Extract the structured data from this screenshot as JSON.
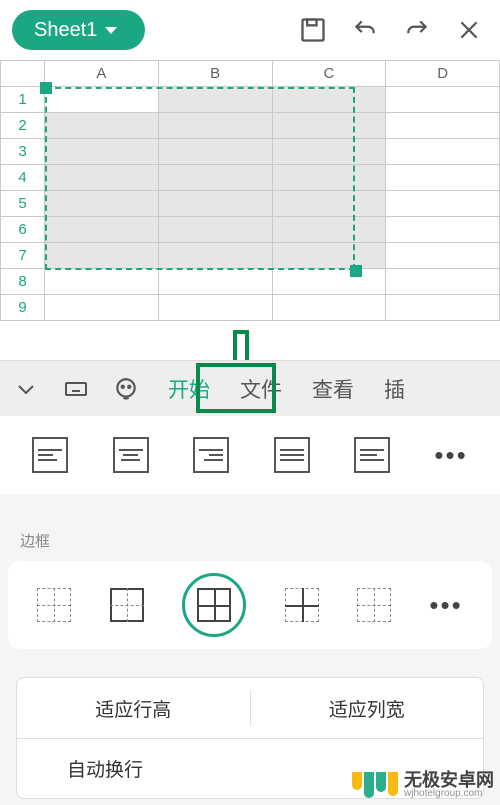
{
  "topbar": {
    "sheet_name": "Sheet1"
  },
  "columns": [
    "A",
    "B",
    "C",
    "D"
  ],
  "rows": [
    "1",
    "2",
    "3",
    "4",
    "5",
    "6",
    "7",
    "8",
    "9"
  ],
  "selection": {
    "start": "A1",
    "end": "C7"
  },
  "ribbon": {
    "tabs": [
      "开始",
      "文件",
      "查看"
    ],
    "tab_partial": "插",
    "active_index": 0
  },
  "borders": {
    "label": "边框",
    "selected_index": 2
  },
  "fit": {
    "row_height": "适应行高",
    "col_width": "适应列宽",
    "wrap": "自动换行"
  },
  "watermark": {
    "title": "无极安卓网",
    "url": "wjhotelgroup.com"
  }
}
